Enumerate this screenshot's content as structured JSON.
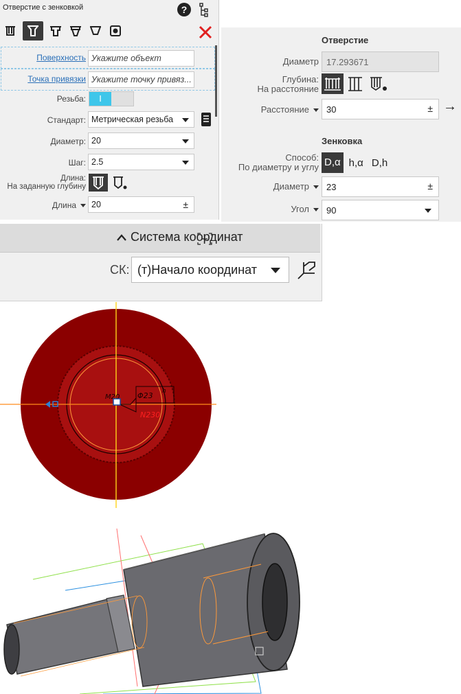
{
  "dialog": {
    "title": "Отверстие с зенковкой",
    "help_icon": "question-circle-icon",
    "tree_icon": "tree-structure-icon",
    "close_icon": "close-icon"
  },
  "toolbar": {
    "icons": [
      "hole-simple-icon",
      "hole-countersink-icon",
      "hole-counterbore-icon",
      "hole-conical-icon",
      "hole-spot-icon",
      "hole-thread-icon"
    ],
    "selected_index": 1
  },
  "left_form": {
    "surface": {
      "label": "Поверхность",
      "placeholder": "Укажите объект"
    },
    "anchor": {
      "label": "Точка привязки",
      "placeholder": "Укажите точку привяз..."
    },
    "thread": {
      "label": "Резьба:",
      "state": "on",
      "on_text": "I"
    },
    "standard": {
      "label": "Стандарт:",
      "value": "Метрическая резьба"
    },
    "diameter": {
      "label": "Диаметр:",
      "value": "20"
    },
    "pitch": {
      "label": "Шаг:",
      "value": "2.5"
    },
    "depth": {
      "label_line1": "Длина:",
      "label_line2": "На заданную глубину"
    },
    "length": {
      "label": "Длина",
      "value": "20",
      "pm": "±"
    }
  },
  "right_form": {
    "hole_section": "Отверстие",
    "diameter": {
      "label": "Диаметр",
      "value": "17.293671"
    },
    "depth": {
      "label_line1": "Глубина:",
      "label_line2": "На расстояние"
    },
    "distance": {
      "label": "Расстояние",
      "value": "30",
      "pm": "±",
      "arrow": "→"
    },
    "csk_section": "Зенковка",
    "method": {
      "label_line1": "Способ:",
      "label_line2": "По диаметру и углу",
      "options": [
        "D,α",
        "h,α",
        "D,h"
      ],
      "selected": 0
    },
    "csk_diameter": {
      "label": "Диаметр",
      "value": "23",
      "pm": "±"
    },
    "angle": {
      "label": "Угол",
      "value": "90"
    }
  },
  "coord_system": {
    "header": "Система координат",
    "header_icon": "chevron-up-icon",
    "label": "СК:",
    "value": "(т)Начало координат",
    "pick_icon": "axis-pick-icon"
  },
  "view_top": {
    "annotations": [
      "M20",
      "Φ23",
      "h",
      "N230"
    ]
  },
  "colors": {
    "panel_bg": "#f0f0f0",
    "link": "#2a6fb8",
    "toggle_on": "#3ec6ea",
    "close_red": "#e02020",
    "part_red": "#8b0000",
    "axis_orange": "#ff8c1a",
    "axis_yellow": "#ffd21a",
    "body_gray": "#6e6e72"
  }
}
